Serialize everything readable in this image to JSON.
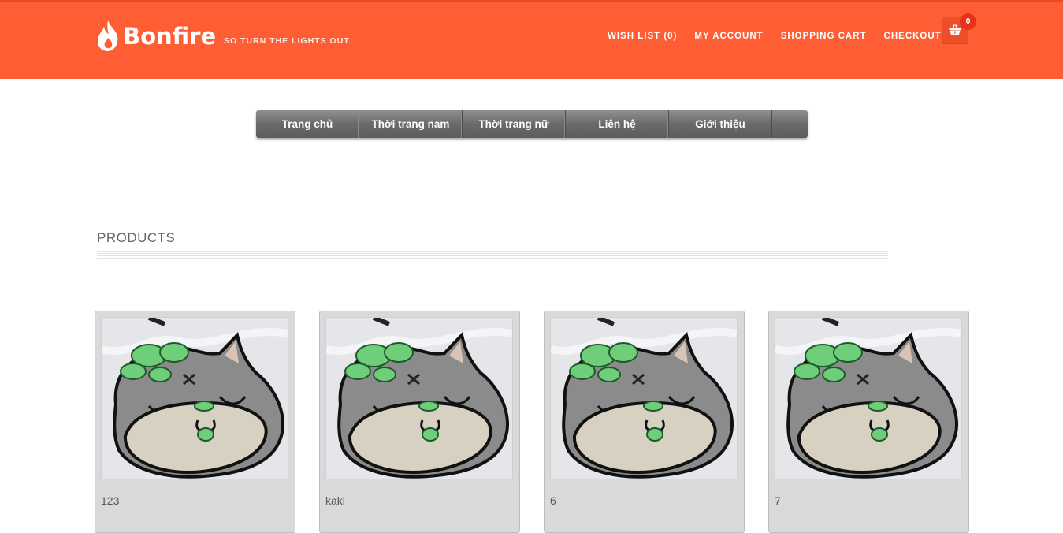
{
  "brand": {
    "name": "Bonfire",
    "tagline": "SO TURN THE LIGHTS OUT"
  },
  "topnav": [
    {
      "label": "WISH LIST (0)"
    },
    {
      "label": "MY ACCOUNT"
    },
    {
      "label": "SHOPPING CART"
    },
    {
      "label": "CHECKOUT"
    }
  ],
  "cart": {
    "icon": "basket-icon",
    "count": "0"
  },
  "mainnav": [
    {
      "label": "Trang chủ"
    },
    {
      "label": "Thời trang nam"
    },
    {
      "label": "Thời trang nữ"
    },
    {
      "label": "Liên hệ"
    },
    {
      "label": "Giới thiệu"
    }
  ],
  "section": {
    "title": "PRODUCTS"
  },
  "products": [
    {
      "name": "123"
    },
    {
      "name": "kaki"
    },
    {
      "name": "6"
    },
    {
      "name": "7"
    }
  ],
  "colors": {
    "header": "#ff5e35",
    "nav": "#6a6a6a",
    "card": "#d9d9d9"
  }
}
